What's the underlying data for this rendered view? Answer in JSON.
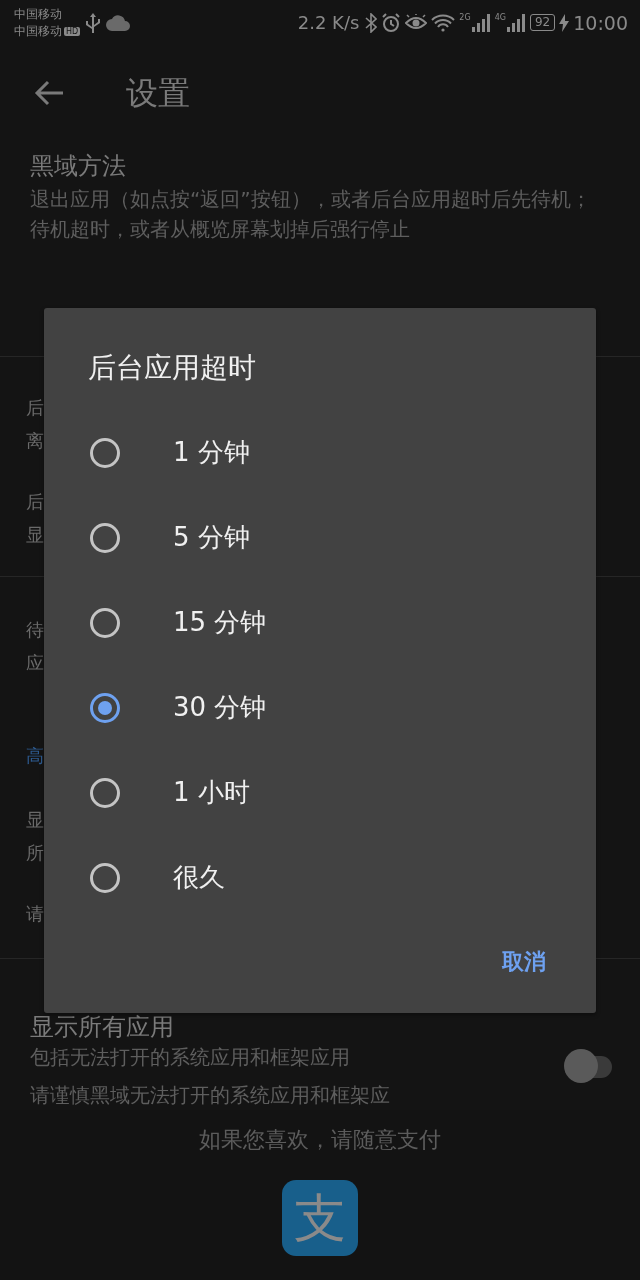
{
  "status_bar": {
    "carriers": [
      "中国移动",
      "中国移动"
    ],
    "hd_badge": "HD",
    "speed": "2.2 K/s",
    "signals": [
      {
        "label": "2G"
      },
      {
        "label": "4G"
      }
    ],
    "battery": "92",
    "charging": true,
    "time": "10:00"
  },
  "toolbar": {
    "title": "设置"
  },
  "settings": [
    {
      "kind": "item",
      "title": "黑域方法",
      "summary": "退出应用（如点按“返回”按钮），或者后台应用超时后先待机；待机超时，或者从概览屏幕划掉后强行停止"
    },
    {
      "kind": "fragment",
      "paragraphs": [
        {
          "kind": "body",
          "lines": [
            "后",
            "离"
          ]
        },
        {
          "kind": "body",
          "lines": [
            "后",
            "显"
          ]
        }
      ]
    },
    {
      "kind": "fragment",
      "paragraphs": [
        {
          "kind": "body",
          "lines": [
            "待",
            "应"
          ]
        },
        {
          "kind": "header",
          "lines": [
            "高"
          ]
        },
        {
          "kind": "body",
          "lines": [
            "显",
            "所"
          ]
        },
        {
          "kind": "body",
          "lines": [
            "请"
          ]
        }
      ]
    },
    {
      "kind": "switch",
      "title": "显示所有应用",
      "summary": "包括无法打开的系统应用和框架应用",
      "on": false,
      "note": "请谨慎黑域无法打开的系统应用和框架应"
    }
  ],
  "dialog": {
    "title": "后台应用超时",
    "options": [
      {
        "label": "1 分钟",
        "selected": false
      },
      {
        "label": "5 分钟",
        "selected": false
      },
      {
        "label": "15 分钟",
        "selected": false
      },
      {
        "label": "30 分钟",
        "selected": true
      },
      {
        "label": "1 小时",
        "selected": false
      },
      {
        "label": "很久",
        "selected": false
      }
    ],
    "button": "取消"
  },
  "footer": {
    "text": "如果您喜欢，请随意支付",
    "logo_text": "支"
  }
}
